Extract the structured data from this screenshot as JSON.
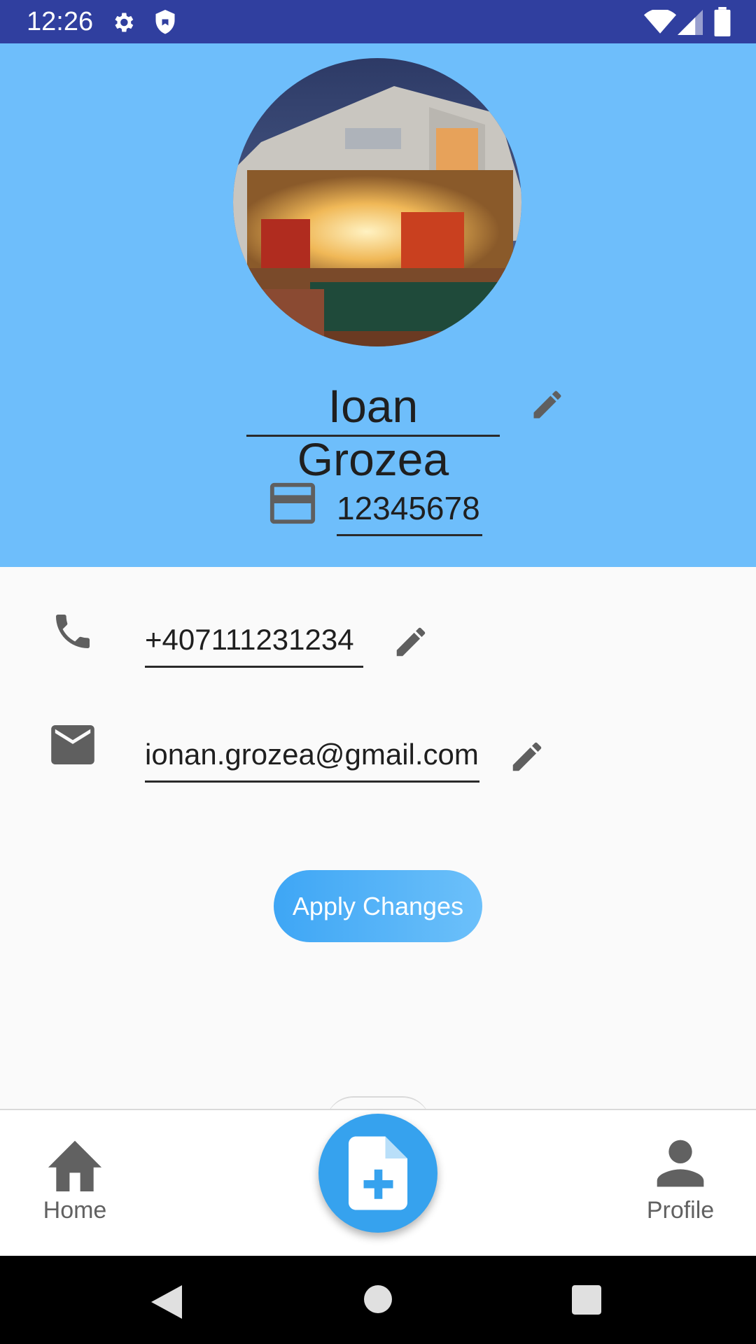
{
  "status_bar": {
    "time": "12:26",
    "icons": [
      "gear-icon",
      "shield-icon",
      "wifi-icon",
      "signal-icon",
      "battery-icon"
    ]
  },
  "profile": {
    "avatar": "house-photo",
    "name": "Ioan Grozea",
    "card_number": "12345678"
  },
  "contacts": {
    "phone": "+407111231234",
    "email": "ionan.grozea@gmail.com"
  },
  "actions": {
    "apply_label": "Apply Changes"
  },
  "bottom_nav": {
    "home_label": "Home",
    "profile_label": "Profile",
    "fab_icon": "add-document-icon"
  },
  "colors": {
    "status_bar": "#303f9f",
    "header": "#6ebefb",
    "accent": "#36a2ee",
    "icon_gray": "#616161"
  }
}
